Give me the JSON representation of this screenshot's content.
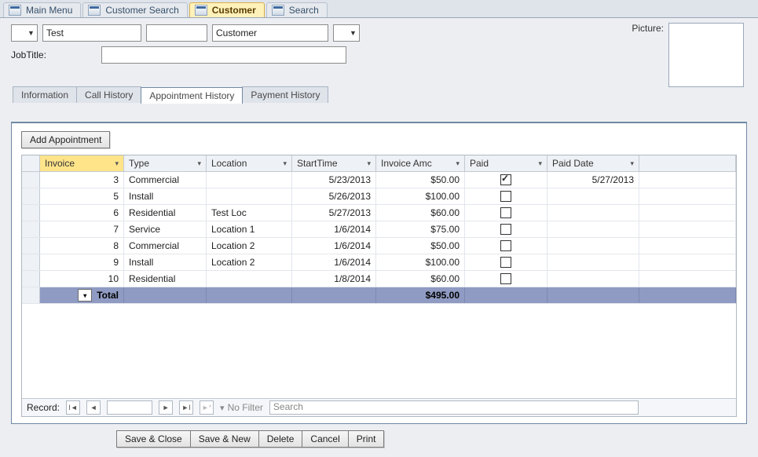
{
  "doctabs": [
    "Main Menu",
    "Customer Search",
    "Customer",
    "Search"
  ],
  "active_doctab": 2,
  "header": {
    "first_name": "Test",
    "mid": "",
    "last_name": "Customer",
    "picture_label": "Picture:",
    "jobtitle_label": "JobTitle:",
    "jobtitle_value": ""
  },
  "tabs": [
    "Information",
    "Call History",
    "Appointment History",
    "Payment History"
  ],
  "active_tab": 2,
  "add_button": "Add Appointment",
  "grid": {
    "columns": [
      "Invoice",
      "Type",
      "Location",
      "StartTime",
      "Invoice Amc",
      "Paid",
      "Paid Date"
    ],
    "sorted_col": 0,
    "rows": [
      {
        "invoice": "3",
        "type": "Commercial",
        "location": "",
        "start": "5/23/2013",
        "amount": "$50.00",
        "paid": true,
        "paid_date": "5/27/2013"
      },
      {
        "invoice": "5",
        "type": "Install",
        "location": "",
        "start": "5/26/2013",
        "amount": "$100.00",
        "paid": false,
        "paid_date": ""
      },
      {
        "invoice": "6",
        "type": "Residential",
        "location": "Test Loc",
        "start": "5/27/2013",
        "amount": "$60.00",
        "paid": false,
        "paid_date": ""
      },
      {
        "invoice": "7",
        "type": "Service",
        "location": "Location 1",
        "start": "1/6/2014",
        "amount": "$75.00",
        "paid": false,
        "paid_date": ""
      },
      {
        "invoice": "8",
        "type": "Commercial",
        "location": "Location 2",
        "start": "1/6/2014",
        "amount": "$50.00",
        "paid": false,
        "paid_date": ""
      },
      {
        "invoice": "9",
        "type": "Install",
        "location": "Location 2",
        "start": "1/6/2014",
        "amount": "$100.00",
        "paid": false,
        "paid_date": ""
      },
      {
        "invoice": "10",
        "type": "Residential",
        "location": "",
        "start": "1/8/2014",
        "amount": "$60.00",
        "paid": false,
        "paid_date": ""
      }
    ],
    "total_label": "Total",
    "total_amount": "$495.00"
  },
  "recnav": {
    "label": "Record:",
    "no_filter": "No Filter",
    "search_placeholder": "Search"
  },
  "actions": [
    "Save & Close",
    "Save & New",
    "Delete",
    "Cancel",
    "Print"
  ]
}
